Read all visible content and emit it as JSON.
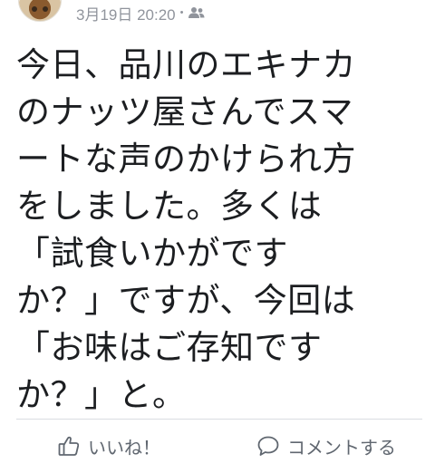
{
  "post": {
    "date": "3月19日 20:20",
    "separator": "•",
    "audience_icon": "friends-icon",
    "message_lines": [
      "今日、品川のエキナカ",
      "のナッツ屋さんでスマ",
      "ートな声のかけられ方",
      "をしました。多くは",
      "「試食いかがです",
      "か？」ですが、今回は",
      "「お味はご存知です",
      "か？」と。"
    ]
  },
  "actions": {
    "like_label": "いいね！",
    "like_icon": "thumbs-up-icon",
    "comment_label": "コメントする",
    "comment_icon": "comment-bubble-icon"
  },
  "colors": {
    "text": "#1c1e21",
    "meta": "#90949c",
    "action": "#606770",
    "divider": "#dadde1"
  }
}
